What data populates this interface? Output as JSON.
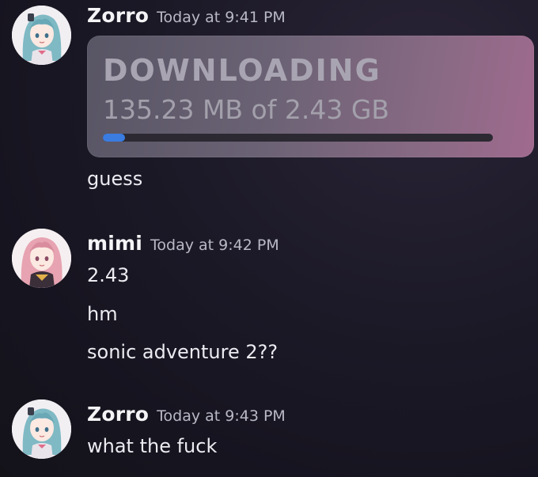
{
  "messages": [
    {
      "author": "Zorro",
      "timestamp": "Today at 9:41 PM",
      "avatar_icon": "anime-avatar-teal-hair",
      "download_card": {
        "title": "DOWNLOADING",
        "size_text": "135.23 MB of 2.43 GB",
        "progress_fraction": 0.056
      },
      "lines": [
        "guess"
      ]
    },
    {
      "author": "mimi",
      "timestamp": "Today at 9:42 PM",
      "avatar_icon": "anime-avatar-pink-hair",
      "lines": [
        "2.43",
        "hm",
        "sonic adventure 2??"
      ]
    },
    {
      "author": "Zorro",
      "timestamp": "Today at 9:43 PM",
      "avatar_icon": "anime-avatar-teal-hair",
      "lines": [
        "what the fuck"
      ]
    }
  ],
  "colors": {
    "background": "#1b1826",
    "progress_fill": "#3a7ce0",
    "username": "#f4f4f6",
    "timestamp": "#b9b9c6"
  }
}
